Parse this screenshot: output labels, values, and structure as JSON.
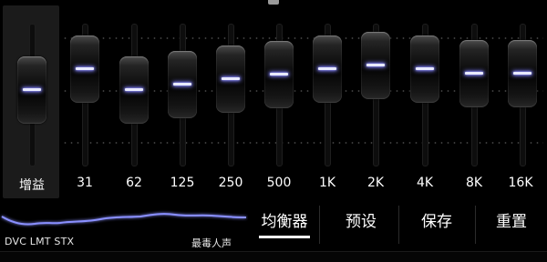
{
  "equalizer": {
    "gain_label": "增益",
    "bands": [
      {
        "label": "31"
      },
      {
        "label": "62"
      },
      {
        "label": "125"
      },
      {
        "label": "250"
      },
      {
        "label": "500"
      },
      {
        "label": "1K"
      },
      {
        "label": "2K"
      },
      {
        "label": "4K"
      },
      {
        "label": "8K"
      },
      {
        "label": "16K"
      }
    ]
  },
  "status": {
    "effects": "DVC LMT STX",
    "preset_name": "最毒人声"
  },
  "tabs": [
    {
      "label": "均衡器",
      "active": true
    },
    {
      "label": "预设",
      "active": false
    },
    {
      "label": "保存",
      "active": false
    },
    {
      "label": "重置",
      "active": false
    }
  ],
  "colors": {
    "accent_glow": "#7d7dff",
    "curve": "#8a90ff"
  }
}
